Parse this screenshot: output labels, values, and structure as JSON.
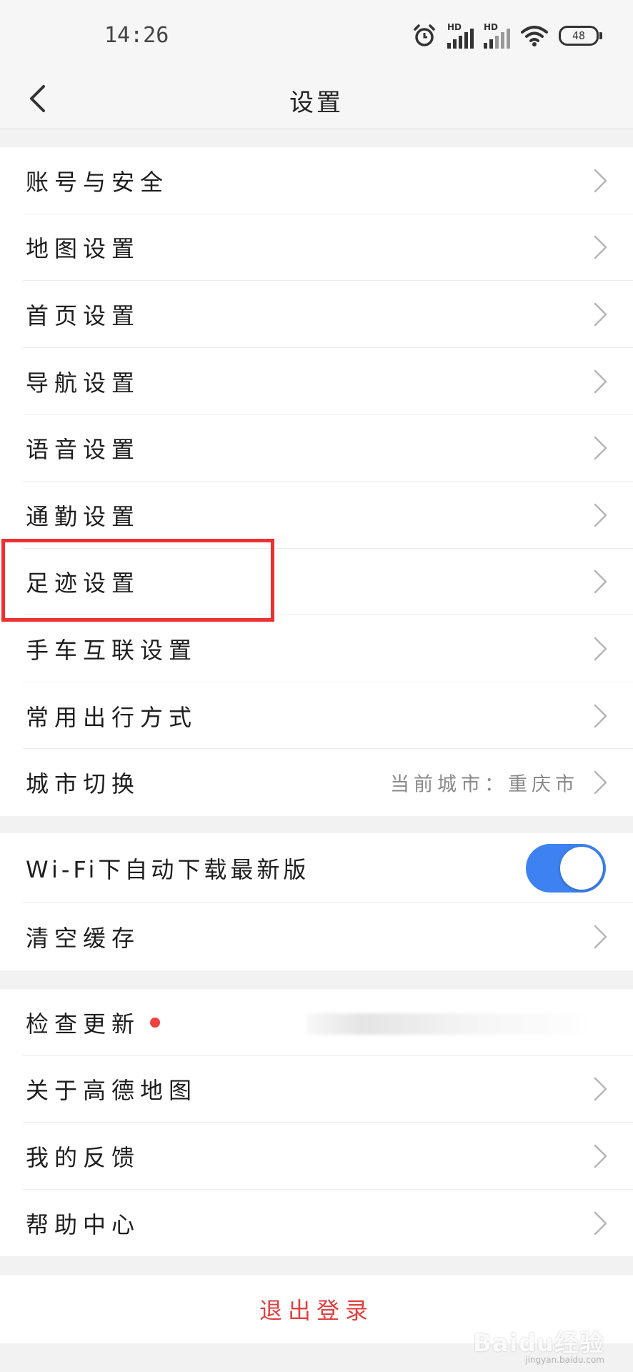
{
  "status_bar": {
    "time": "14:26",
    "network_label": "HD",
    "battery": "48"
  },
  "header": {
    "title": "设置",
    "back_icon": "chevron-left-icon"
  },
  "group1": [
    {
      "label": "账号与安全"
    },
    {
      "label": "地图设置"
    },
    {
      "label": "首页设置"
    },
    {
      "label": "导航设置"
    },
    {
      "label": "语音设置"
    },
    {
      "label": "通勤设置"
    },
    {
      "label": "足迹设置"
    },
    {
      "label": "手车互联设置"
    },
    {
      "label": "常用出行方式"
    },
    {
      "label": "城市切换",
      "value": "当前城市：重庆市"
    }
  ],
  "group2": {
    "wifi_download": {
      "label": "Wi-Fi下自动下载最新版",
      "enabled": true
    },
    "clear_cache": {
      "label": "清空缓存"
    }
  },
  "group3": [
    {
      "label": "检查更新",
      "badge": "red-dot"
    },
    {
      "label": "关于高德地图"
    },
    {
      "label": "我的反馈"
    },
    {
      "label": "帮助中心"
    }
  ],
  "logout": {
    "label": "退出登录"
  },
  "watermark": {
    "text": "Baidu经验",
    "sub": "jingyan.baidu.com"
  },
  "colors": {
    "accent_toggle": "#3d82f0",
    "logout_text": "#e24040",
    "highlight": "#ee3030",
    "badge": "#f04040"
  }
}
